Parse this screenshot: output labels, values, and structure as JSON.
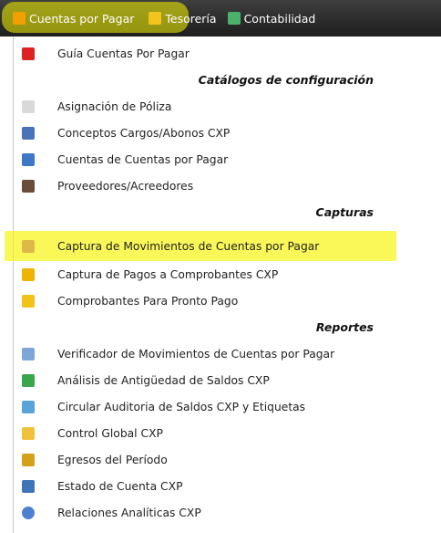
{
  "menubar": {
    "tabs": [
      {
        "label": "Cuentas por Pagar",
        "icon": "ledger-icon"
      },
      {
        "label": "Tesorería",
        "icon": "coins-icon"
      },
      {
        "label": "Contabilidad",
        "icon": "accounting-icon"
      }
    ]
  },
  "menu": {
    "items": [
      {
        "type": "item",
        "label": "Guía Cuentas Por Pagar",
        "icon": "pdf-icon"
      },
      {
        "type": "header",
        "label": "Catálogos de configuración"
      },
      {
        "type": "item",
        "label": "Asignación de Póliza",
        "icon": "grid-icon"
      },
      {
        "type": "item",
        "label": "Conceptos Cargos/Abonos CXP",
        "icon": "book-icon"
      },
      {
        "type": "item",
        "label": "Cuentas de Cuentas por Pagar",
        "icon": "ledger-book-icon"
      },
      {
        "type": "item",
        "label": "Proveedores/Acreedores",
        "icon": "user-icon"
      },
      {
        "type": "header",
        "label": "Capturas"
      },
      {
        "type": "item",
        "label": "Captura de Movimientos de Cuentas por Pagar",
        "icon": "edit-note-icon",
        "highlighted": true
      },
      {
        "type": "item",
        "label": "Captura de Pagos a Comprobantes CXP",
        "icon": "coins-add-icon"
      },
      {
        "type": "item",
        "label": "Comprobantes Para Pronto Pago",
        "icon": "lightning-icon"
      },
      {
        "type": "header",
        "label": "Reportes"
      },
      {
        "type": "item",
        "label": "Verificador de Movimientos de Cuentas por Pagar",
        "icon": "copy-icon"
      },
      {
        "type": "item",
        "label": "Análisis de Antigüedad de Saldos CXP",
        "icon": "dollar-icon"
      },
      {
        "type": "item",
        "label": "Circular Auditoria de Saldos CXP y Etiquetas",
        "icon": "arrow-icon"
      },
      {
        "type": "item",
        "label": "Control Global CXP",
        "icon": "folder-icon"
      },
      {
        "type": "item",
        "label": "Egresos del Período",
        "icon": "coins-stack-icon"
      },
      {
        "type": "item",
        "label": "Estado de Cuenta CXP",
        "icon": "report-edit-icon"
      },
      {
        "type": "item",
        "label": "Relaciones Analíticas CXP",
        "icon": "pie-chart-icon"
      }
    ]
  },
  "colors": {
    "highlight": "#f7f500",
    "menubar": "#2f2f2f"
  }
}
